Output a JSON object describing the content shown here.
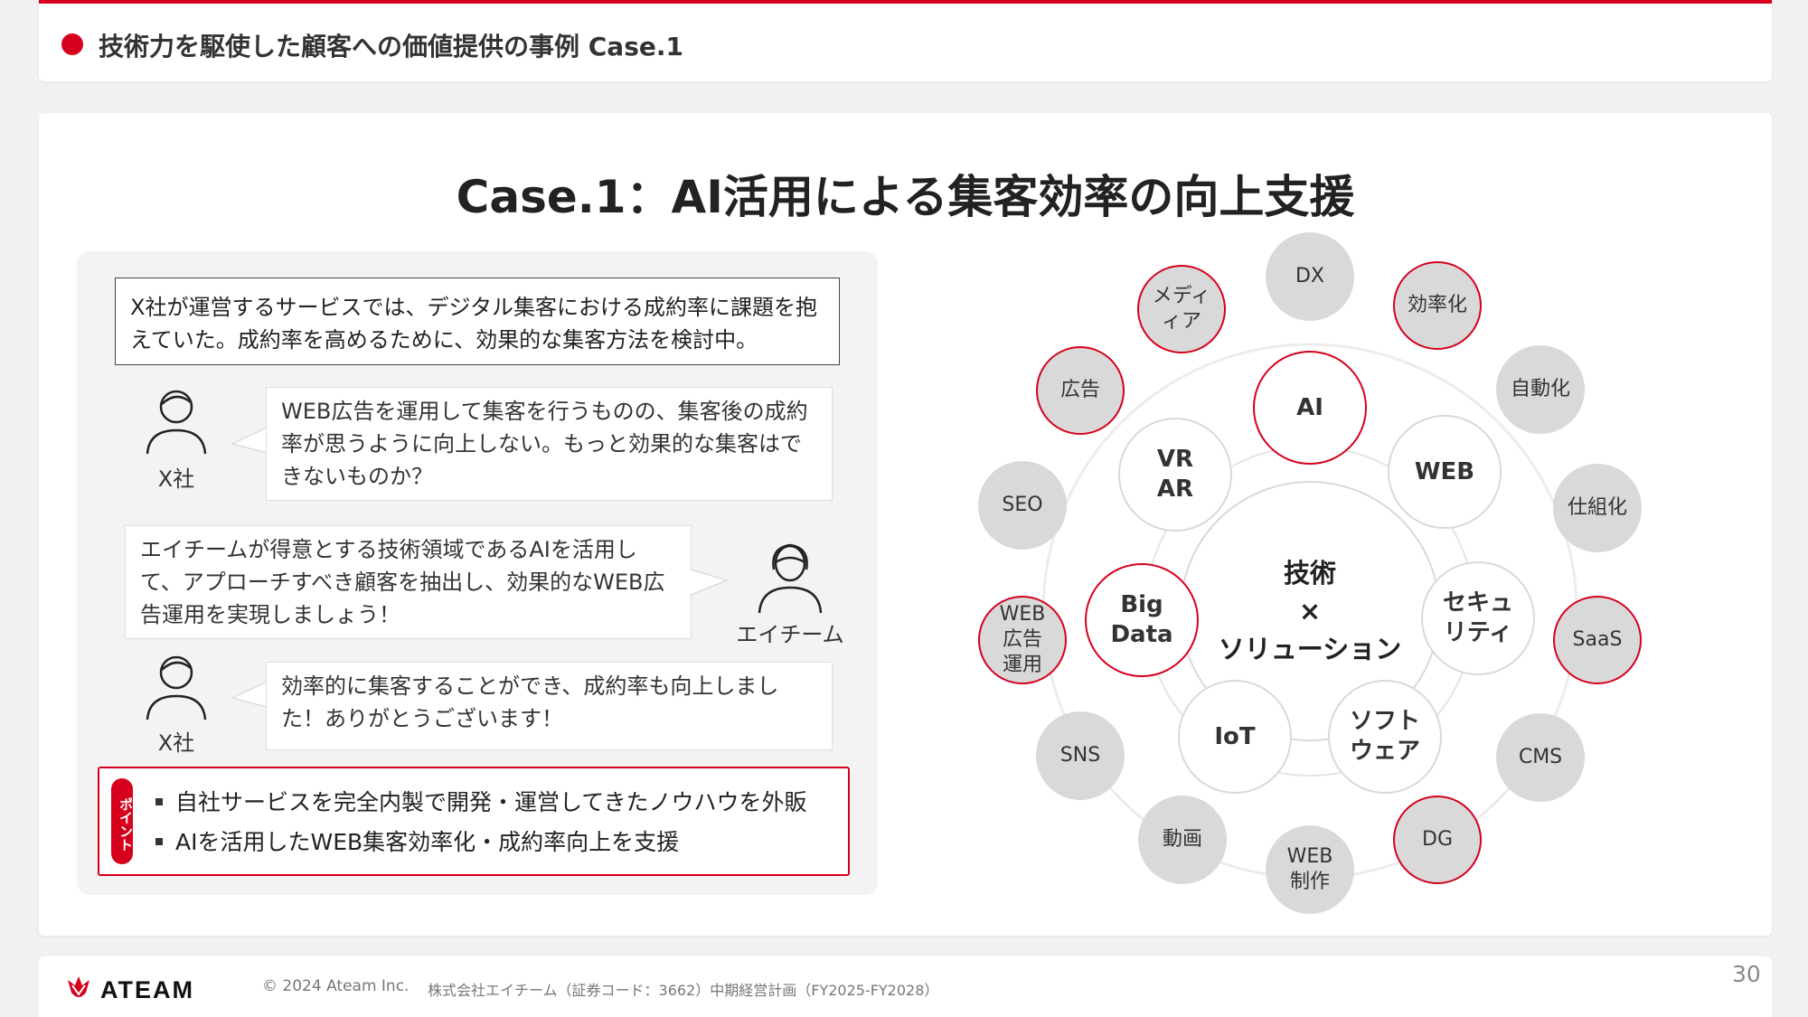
{
  "header": {
    "title": "技術力を駆使した顧客への価値提供の事例 Case.1"
  },
  "case_title": "Case.1：AI活用による集客効率の向上支援",
  "story": {
    "intro": "X社が運営するサービスでは、デジタル集客における成約率に課題を抱えていた。成約率を高めるために、効果的な集客方法を検討中。",
    "dialog": [
      {
        "speaker": "X社",
        "text": "WEB広告を運用して集客を行うものの、集客後の成約率が思うように向上しない。もっと効果的な集客はできないものか？"
      },
      {
        "speaker": "エイチーム",
        "text": "エイチームが得意とする技術領域であるAIを活用して、アプローチすべき顧客を抽出し、効果的なWEB広告運用を実現しましょう！"
      },
      {
        "speaker": "X社",
        "text": "効率的に集客することができ、成約率も向上しました！ありがとうございます！"
      }
    ],
    "point_label": "ポイント",
    "points": [
      "自社サービスを完全内製で開発・運営してきたノウハウを外販",
      "AIを活用したWEB集客効率化・成約率向上を支援"
    ]
  },
  "diagram": {
    "center": "技術\n×\nソリューション",
    "inner": [
      {
        "label": "AI",
        "highlight": true
      },
      {
        "label": "WEB",
        "highlight": false
      },
      {
        "label": "セキュ\nリティ",
        "highlight": false
      },
      {
        "label": "ソフト\nウェア",
        "highlight": false
      },
      {
        "label": "IoT",
        "highlight": false
      },
      {
        "label": "Big\nData",
        "highlight": true
      },
      {
        "label": "VR\nAR",
        "highlight": false
      }
    ],
    "outer": [
      {
        "label": "DX",
        "highlight": false
      },
      {
        "label": "効率化",
        "highlight": true
      },
      {
        "label": "自動化",
        "highlight": false
      },
      {
        "label": "仕組化",
        "highlight": false
      },
      {
        "label": "SaaS",
        "highlight": true
      },
      {
        "label": "CMS",
        "highlight": false
      },
      {
        "label": "DG",
        "highlight": true
      },
      {
        "label": "WEB\n制作",
        "highlight": false
      },
      {
        "label": "動画",
        "highlight": false
      },
      {
        "label": "SNS",
        "highlight": false
      },
      {
        "label": "WEB\n広告\n運用",
        "highlight": true
      },
      {
        "label": "SEO",
        "highlight": false
      },
      {
        "label": "広告",
        "highlight": true
      },
      {
        "label": "メディ\nィア",
        "highlight": true
      }
    ]
  },
  "footer": {
    "logo": "ATEAM",
    "copyright": "© 2024 Ateam Inc.",
    "company": "株式会社エイチーム（証券コード：3662）中期経営計画（FY2025-FY2028）",
    "page": "30"
  },
  "colors": {
    "accent": "#d6001c",
    "gray_circle": "#d9d9d9"
  }
}
